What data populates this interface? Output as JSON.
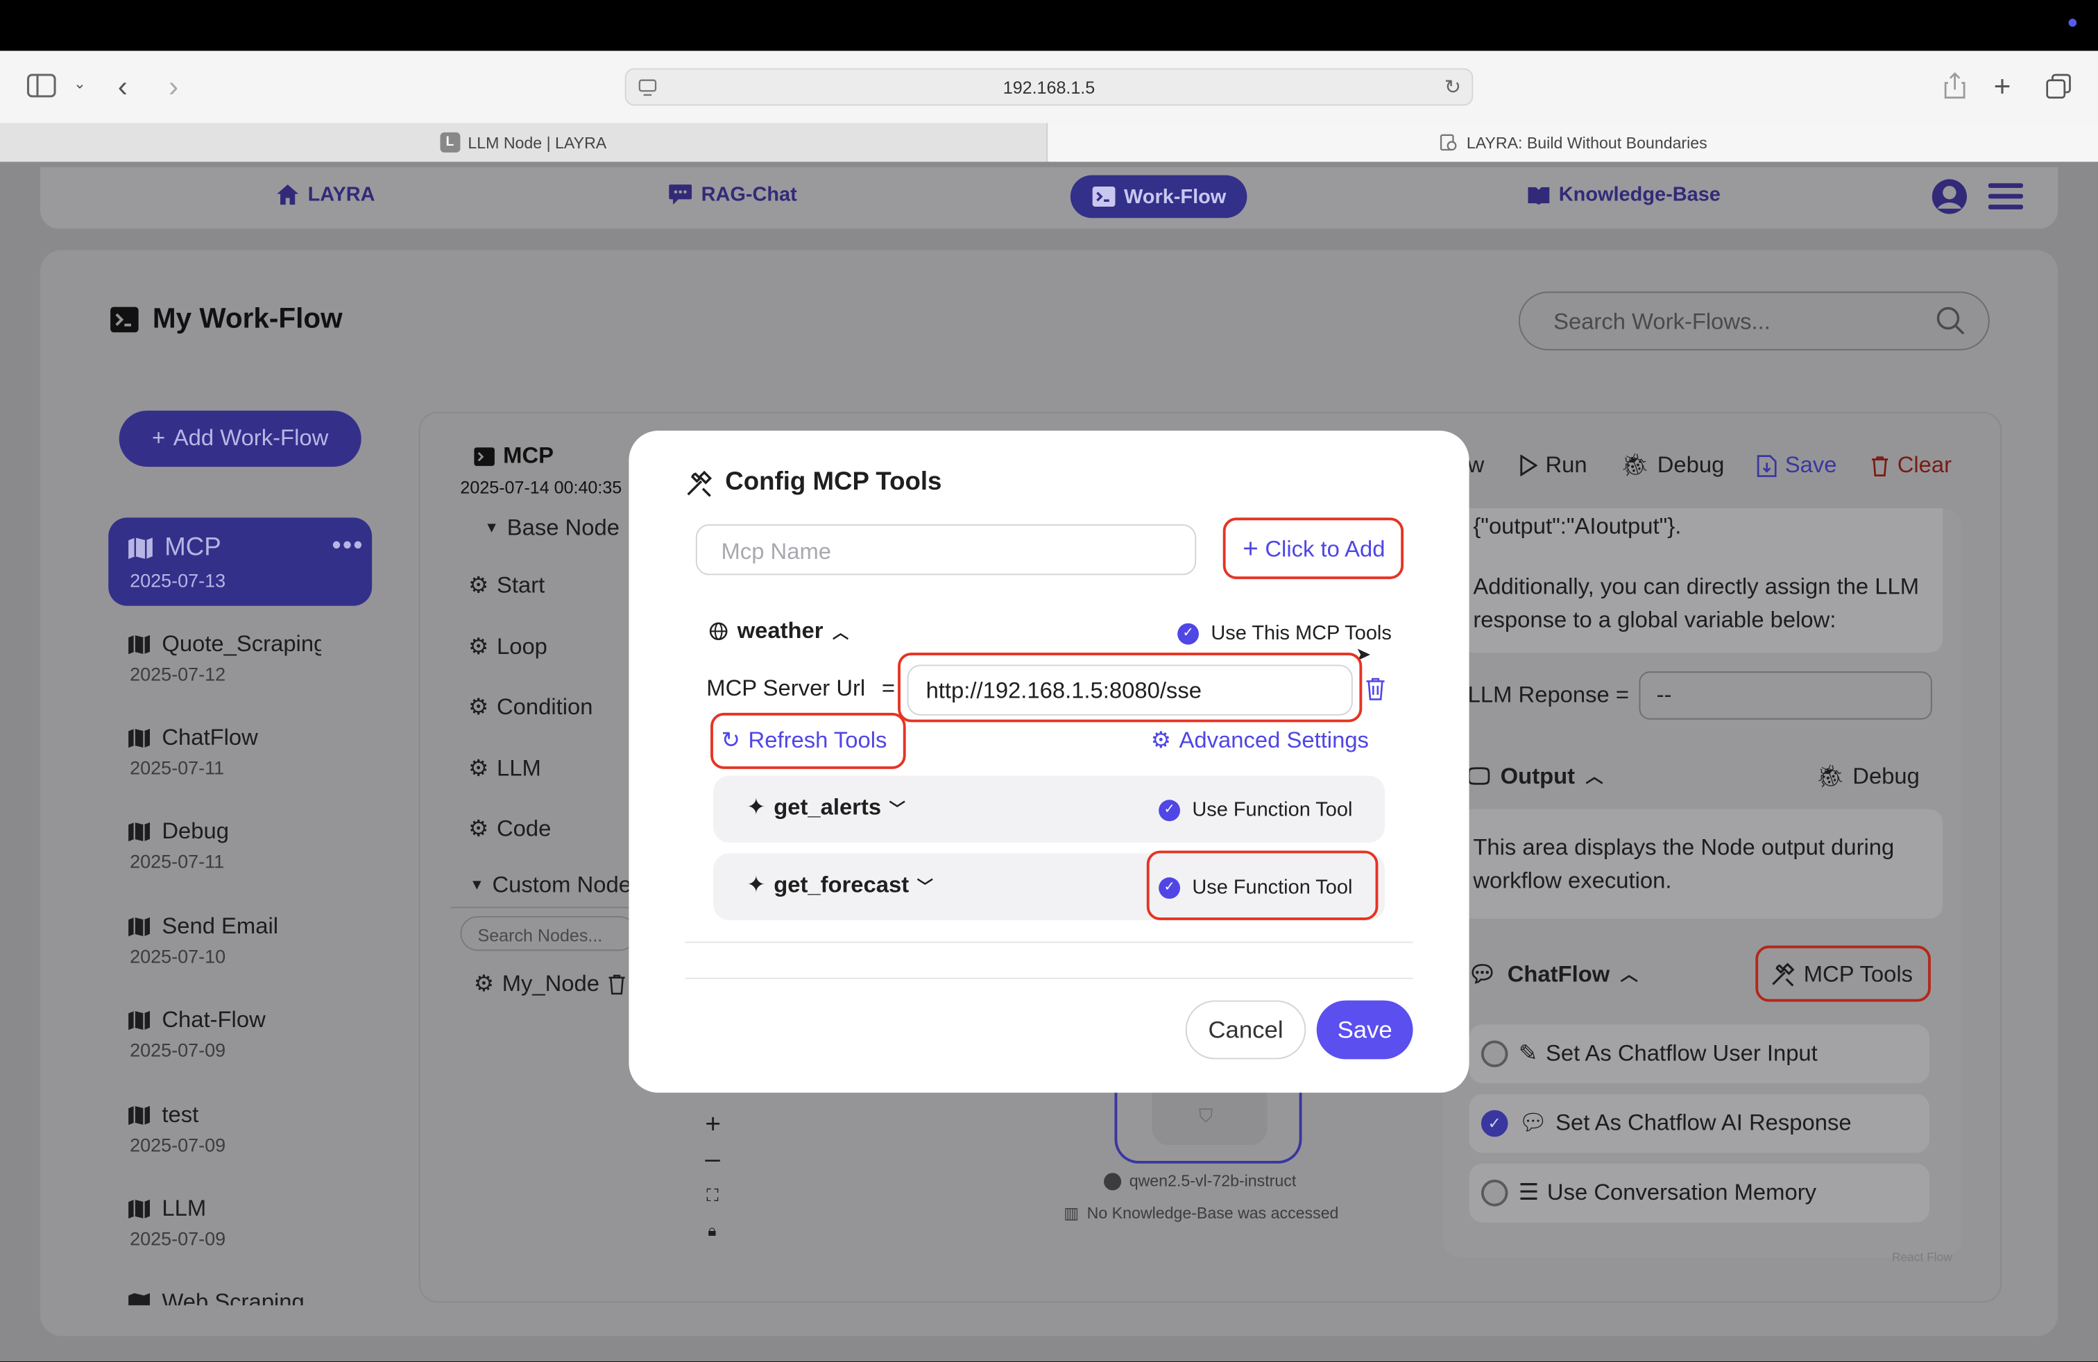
{
  "browser": {
    "url": "192.168.1.5",
    "tabs": [
      {
        "label": "LLM Node | LAYRA",
        "favicon": "L"
      },
      {
        "label": "LAYRA: Build Without Boundaries"
      }
    ]
  },
  "nav": {
    "items": [
      "LAYRA",
      "RAG-Chat",
      "Work-Flow",
      "Knowledge-Base"
    ],
    "active": "Work-Flow"
  },
  "page": {
    "title": "My Work-Flow",
    "search_placeholder": "Search Work-Flows...",
    "add_button": "Add Work-Flow"
  },
  "workflows": [
    {
      "name": "MCP",
      "date": "2025-07-13",
      "selected": true
    },
    {
      "name": "Quote_Scraping",
      "date": "2025-07-12"
    },
    {
      "name": "ChatFlow",
      "date": "2025-07-11"
    },
    {
      "name": "Debug",
      "date": "2025-07-11"
    },
    {
      "name": "Send Email",
      "date": "2025-07-10"
    },
    {
      "name": "Chat-Flow",
      "date": "2025-07-09"
    },
    {
      "name": "test",
      "date": "2025-07-09"
    },
    {
      "name": "LLM",
      "date": "2025-07-09"
    },
    {
      "name": "Web Scraping"
    }
  ],
  "editor": {
    "flow_name": "MCP",
    "timestamp": "2025-07-14 00:40:35",
    "toolbar": {
      "flow_partial": "w",
      "run": "Run",
      "debug": "Debug",
      "save": "Save",
      "clear": "Clear"
    },
    "base_node_label": "Base Node",
    "base_nodes": [
      "Start",
      "Loop",
      "Condition",
      "LLM",
      "Code"
    ],
    "custom_node_label": "Custom Node",
    "search_nodes_placeholder": "Search Nodes...",
    "custom_nodes": [
      "My_Node"
    ]
  },
  "right_panel": {
    "output_example": "{\"output\":\"AIoutput\"}.",
    "assign_text": "Additionally, you can directly assign the LLM response to a global variable below:",
    "llm_response_label": "LLM Reponse =",
    "llm_response_value": "--",
    "output_label": "Output",
    "debug_label": "Debug",
    "output_desc": "This area displays the Node output during workflow execution.",
    "chatflow_label": "ChatFlow",
    "mcp_tools_label": "MCP Tools",
    "options": [
      {
        "label": "Set As Chatflow User Input",
        "checked": false
      },
      {
        "label": "Set As Chatflow AI Response",
        "checked": true
      },
      {
        "label": "Use Conversation Memory",
        "checked": false
      }
    ],
    "react_flow_label": "React Flow"
  },
  "canvas": {
    "model": "qwen2.5-vl-72b-instruct",
    "kb_status": "No Knowledge-Base was accessed"
  },
  "modal": {
    "title": "Config MCP Tools",
    "name_placeholder": "Mcp Name",
    "add_label": "Click to Add",
    "server": {
      "name": "weather",
      "use_label": "Use This MCP Tools",
      "use_checked": true,
      "url_label": "MCP Server Url",
      "equals": "=",
      "url_value": "http://192.168.1.5:8080/sse",
      "refresh_label": "Refresh Tools",
      "advanced_label": "Advanced Settings"
    },
    "tools": [
      {
        "name": "get_alerts",
        "use_label": "Use Function Tool",
        "checked": true
      },
      {
        "name": "get_forecast",
        "use_label": "Use Function Tool",
        "checked": true
      }
    ],
    "cancel_label": "Cancel",
    "save_label": "Save"
  },
  "colors": {
    "accent": "#4f46e5",
    "highlight": "#e53423",
    "nav_active": "#33308a"
  }
}
